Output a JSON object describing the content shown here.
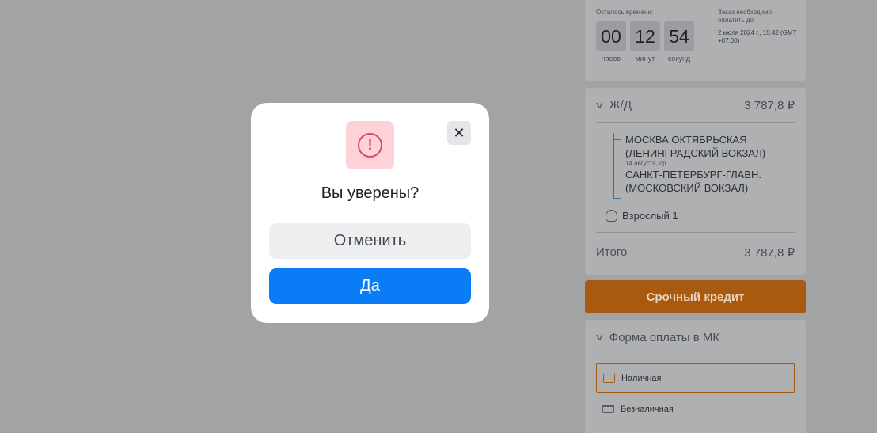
{
  "timer": {
    "remaining_label": "Осталось времени:",
    "hours": "00",
    "minutes": "12",
    "seconds": "54",
    "hours_label": "часов",
    "minutes_label": "минут",
    "seconds_label": "секунд",
    "deadline_label": "Заказ необходимо оплатить до",
    "deadline_value": "2 июля 2024 г., 15:42 (GMT +07:00)"
  },
  "order": {
    "section_title": "Ж/Д",
    "section_price": "3 787,8 ₽",
    "departure": "МОСКВА ОКТЯБРЬСКАЯ (ЛЕНИНГРАДСКИЙ ВОКЗАЛ)",
    "date": "14 августа, ср",
    "arrival": "САНКТ-ПЕТЕРБУРГ-ГЛАВН. (МОСКОВСКИЙ ВОКЗАЛ)",
    "passenger": "Взрослый 1",
    "total_label": "Итого",
    "total_value": "3 787,8 ₽"
  },
  "credit_button": "Срочный кредит",
  "payment": {
    "title": "Форма оплаты в МК",
    "options": [
      {
        "label": "Наличная",
        "selected": true
      },
      {
        "label": "Безналичная",
        "selected": false
      }
    ]
  },
  "dialog": {
    "title": "Вы уверены?",
    "cancel_label": "Отменить",
    "confirm_label": "Да",
    "close_glyph": "✕",
    "warning_glyph": "!"
  },
  "colors": {
    "accent": "#0a7cf5",
    "credit": "#a85a10",
    "warning": "#e04a5e"
  }
}
